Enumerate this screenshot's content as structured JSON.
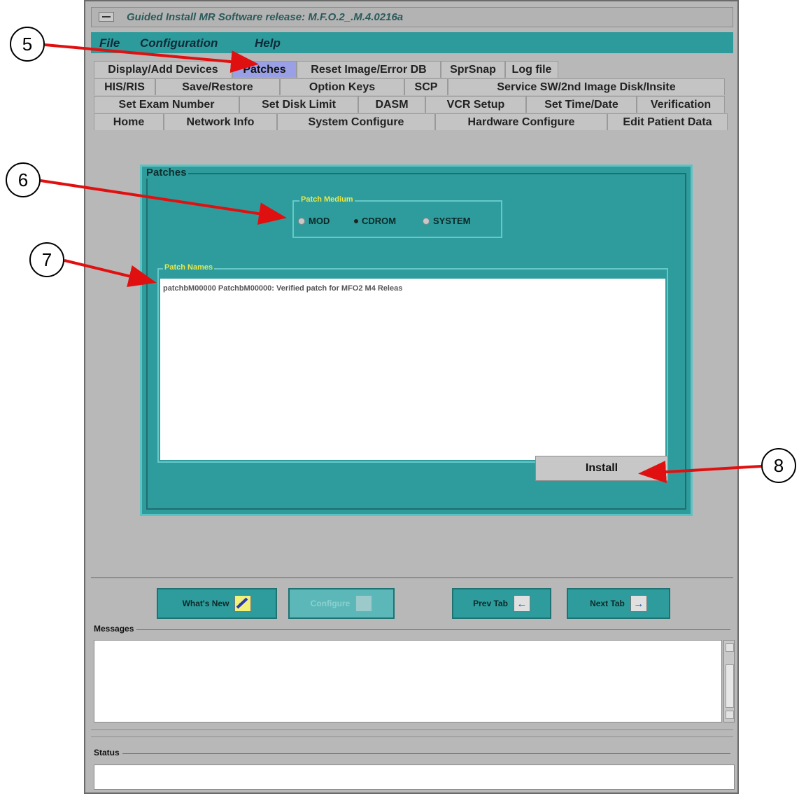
{
  "window": {
    "title": "Guided Install  MR Software release: M.F.O.2_.M.4.0216a"
  },
  "menubar": {
    "items": [
      "File",
      "Configuration",
      "Help"
    ]
  },
  "tabs": {
    "row1": [
      "Display/Add Devices",
      "Patches",
      "Reset Image/Error DB",
      "SprSnap",
      "Log file"
    ],
    "row2": [
      "HIS/RIS",
      "Save/Restore",
      "Option Keys",
      "SCP",
      "Service SW/2nd Image Disk/Insite"
    ],
    "row3": [
      "Set Exam Number",
      "Set Disk Limit",
      "DASM",
      "VCR Setup",
      "Set Time/Date",
      "Verification"
    ],
    "row4": [
      "Home",
      "Network Info",
      "System Configure",
      "Hardware Configure",
      "Edit Patient Data"
    ],
    "active": "Patches"
  },
  "patches": {
    "panel_label": "Patches",
    "medium_label": "Patch Medium",
    "medium_options": [
      "MOD",
      "CDROM",
      "SYSTEM"
    ],
    "medium_selected": "CDROM",
    "names_label": "Patch Names",
    "names_items": [
      "patchbM00000 PatchbM00000: Verified patch for MFO2 M4 Releas"
    ],
    "install_label": "Install"
  },
  "nav": {
    "whats_new": "What's New",
    "configure": "Configure",
    "prev_tab": "Prev Tab",
    "next_tab": "Next Tab"
  },
  "messages_label": "Messages",
  "status_label": "Status",
  "callouts": [
    "5",
    "6",
    "7",
    "8"
  ],
  "colors": {
    "teal": "#2e9c9c",
    "active_tab": "#9aa0e6",
    "arrow": "#e01010",
    "label_yellow": "#e8e84a"
  }
}
